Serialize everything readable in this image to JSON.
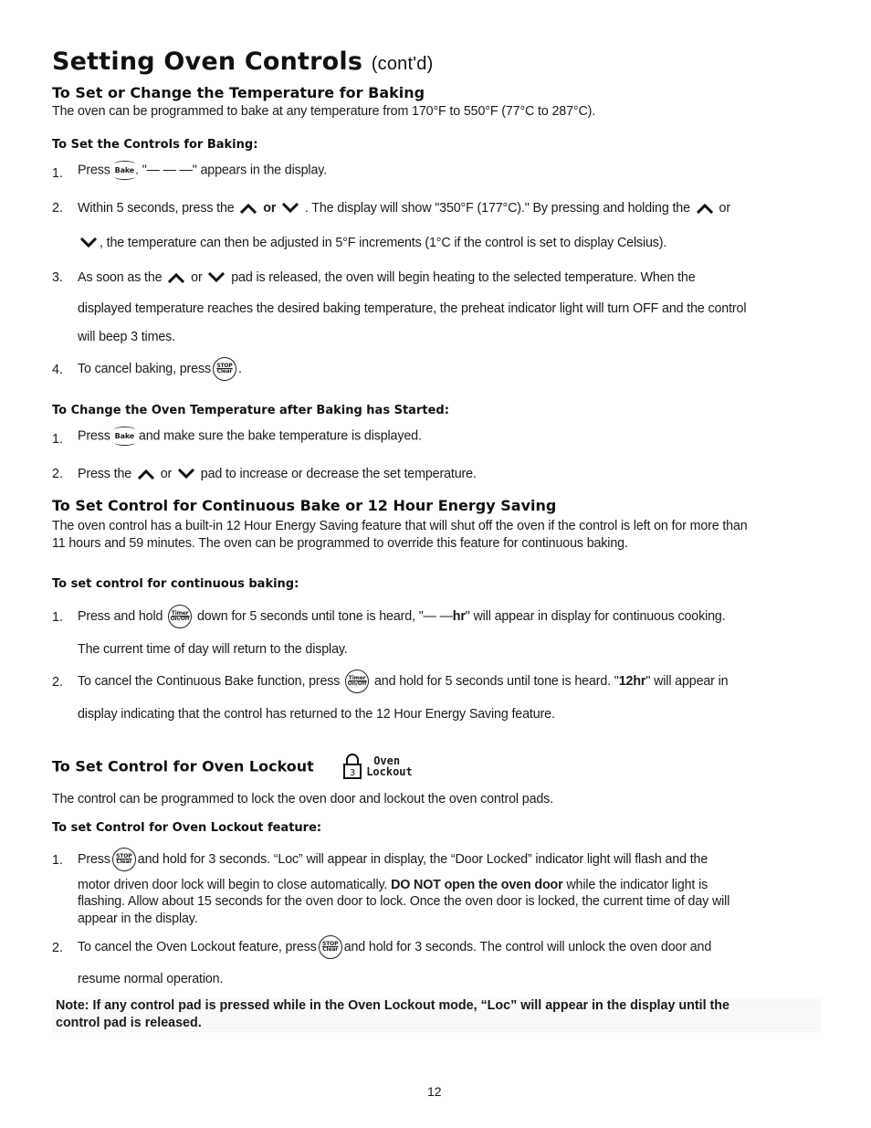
{
  "title": {
    "main": "Setting Oven Controls",
    "suffix": "(cont'd)"
  },
  "section1": {
    "heading": "To Set or Change the Temperature for Baking",
    "intro": "The oven can be programmed to bake at any temperature from 170°F to 550°F (77°C to 287°C).",
    "sub1": {
      "heading": "To Set the Controls for Baking:",
      "steps": [
        {
          "num": "1.",
          "pre": "Press",
          "key": "Bake",
          "post": ". \"— — —\" appears in the display."
        },
        {
          "num": "2.",
          "pre": "Within 5 seconds, press the",
          "or": "or",
          "post": ". The display will show \"350°F (177°C).\" By pressing and holding the",
          "or2": "or",
          "cont": ", the temperature can then be adjusted in 5°F increments (1°C if the control is set to display Celsius)."
        },
        {
          "num": "3.",
          "pre": "As soon as the",
          "or": "or",
          "post": "pad is released, the oven will begin heating to the selected temperature. When the",
          "line2": "displayed temperature reaches the desired baking temperature, the preheat indicator light will turn OFF and the control",
          "line3": "will beep 3 times."
        },
        {
          "num": "4.",
          "pre": "To cancel baking, press",
          "post": "."
        }
      ]
    },
    "sub2": {
      "heading": "To Change the Oven Temperature after Baking has Started:",
      "steps": [
        {
          "num": "1.",
          "pre": "Press",
          "key": "Bake",
          "post": "and make sure the bake temperature is displayed."
        },
        {
          "num": "2.",
          "pre": "Press the",
          "or": "or",
          "post": "pad to increase or decrease the set temperature."
        }
      ]
    }
  },
  "section2": {
    "heading": "To Set Control for Continuous Bake or 12 Hour Energy Saving",
    "intro_line1": "The oven control has a built-in 12 Hour Energy Saving feature that will shut off the oven if the control is left on for more than",
    "intro_line2": "11 hours and 59 minutes. The oven can be programmed to override this feature for continuous baking.",
    "sub": {
      "heading": "To set control for continuous baking:",
      "steps": [
        {
          "num": "1.",
          "pre": "Press and hold",
          "post": "down for 5 seconds until tone is heard, \"— —",
          "bold": "hr",
          "post2": "\" will appear in display for continuous cooking.",
          "line2": "The current time of day will return to the display."
        },
        {
          "num": "2.",
          "pre": "To cancel the Continuous Bake function, press",
          "post": "and hold for 5 seconds until tone is heard. \"",
          "bold": "12hr",
          "post2": "\" will appear in",
          "line2": "display indicating that the control has returned to the 12 Hour Energy Saving feature."
        }
      ]
    }
  },
  "section3": {
    "heading": "To Set Control for Oven Lockout",
    "icon_label_line1": "Oven",
    "icon_label_line2": "Lockout",
    "icon_number": "3",
    "intro": "The control can be programmed to lock the oven door and lockout the oven control pads.",
    "sub": {
      "heading": "To set Control for Oven Lockout feature:",
      "steps": [
        {
          "num": "1.",
          "pre": "Press",
          "post": "and hold for 3 seconds. “Loc” will appear in display, the “Door Locked” indicator light will flash and the",
          "line2_pre": "motor driven door lock will begin to close automatically.",
          "line2_bold": "DO NOT open the oven door",
          "line2_post": "while the indicator light is",
          "line3": "flashing. Allow about 15 seconds for the oven door to lock. Once the oven door is locked, the current time of day will",
          "line4": "appear in the display."
        },
        {
          "num": "2.",
          "pre": "To cancel the Oven Lockout feature, press",
          "post": "and hold for 3 seconds. The control will unlock the oven door and",
          "line2": "resume normal operation."
        }
      ]
    }
  },
  "note": {
    "line1": "Note: If any control pad is pressed while in the Oven Lockout mode, “Loc” will appear in the display until the",
    "line2": "control pad is released."
  },
  "keys": {
    "bake": "Bake",
    "stop_top": "STOP",
    "stop_bottom": "Clear",
    "timer_top": "Timer",
    "timer_bottom": "On/Off"
  },
  "icons": {
    "up": "up-arrow-pad-icon",
    "down": "down-arrow-pad-icon",
    "stop_clear": "stop-clear-key-icon",
    "timer": "timer-on-off-key-icon",
    "bake": "bake-key-icon",
    "lock": "oven-lockout-key-icon"
  },
  "page_number": "12"
}
